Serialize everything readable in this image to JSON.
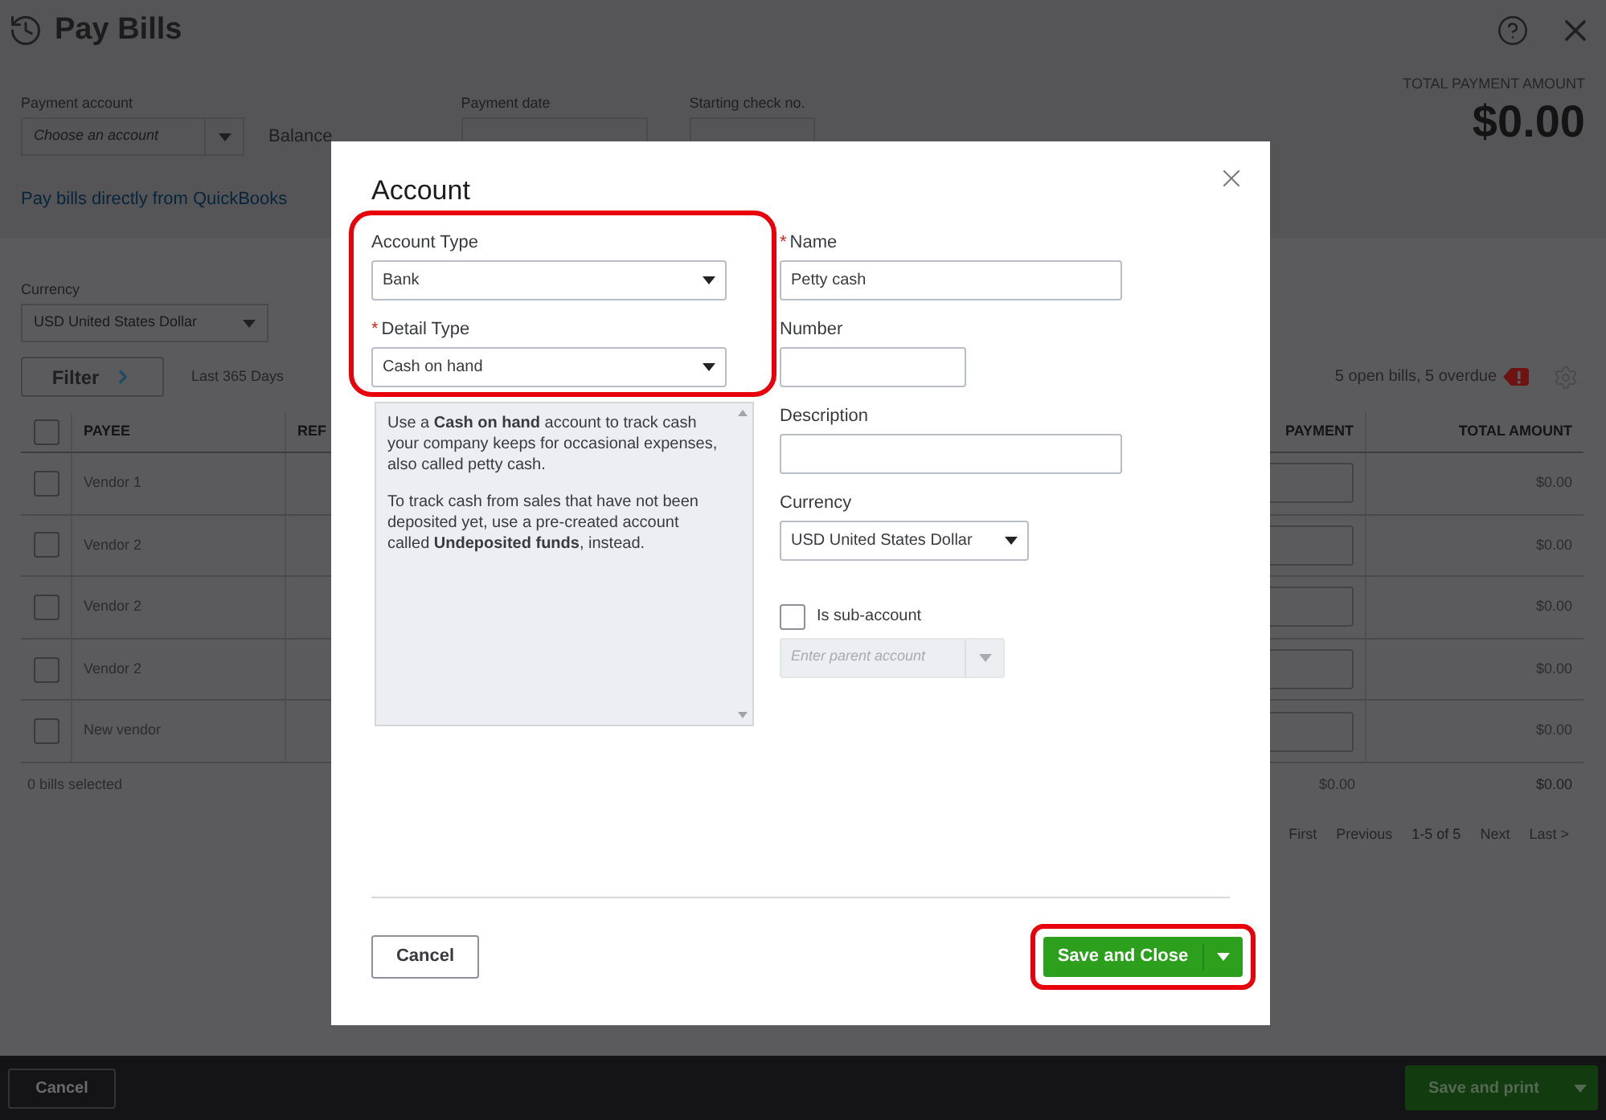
{
  "header": {
    "title": "Pay Bills"
  },
  "payment_account": {
    "label": "Payment account",
    "placeholder": "Choose an account"
  },
  "balance_label": "Balance",
  "payment_date": {
    "label": "Payment date"
  },
  "starting_check": {
    "label": "Starting check no."
  },
  "total": {
    "label": "TOTAL PAYMENT AMOUNT",
    "amount": "$0.00"
  },
  "link": "Pay bills directly from QuickBooks",
  "currency": {
    "label": "Currency",
    "value": "USD United States Dollar"
  },
  "filter": {
    "label": "Filter",
    "range": "Last 365 Days"
  },
  "summary": "5 open bills, 5 overdue",
  "table": {
    "columns": [
      "PAYEE",
      "REF",
      "PAYMENT",
      "TOTAL AMOUNT"
    ],
    "header_checked": false,
    "rows": [
      {
        "payee": "Vendor 1",
        "total": "$0.00",
        "checked": false
      },
      {
        "payee": "Vendor 2",
        "total": "$0.00",
        "checked": false
      },
      {
        "payee": "Vendor 2",
        "total": "$0.00",
        "checked": false
      },
      {
        "payee": "Vendor 2",
        "total": "$0.00",
        "checked": false
      },
      {
        "payee": "New vendor",
        "total": "$0.00",
        "checked": false
      }
    ],
    "footer": {
      "selected": "0 bills selected",
      "payment": "$0.00",
      "total": "$0.00"
    }
  },
  "pagination": [
    {
      "label": "First",
      "kind": "link"
    },
    {
      "label": "Previous",
      "kind": "link"
    },
    {
      "label": "1-5 of 5",
      "kind": "range"
    },
    {
      "label": "Next",
      "kind": "link"
    },
    {
      "label": "Last >",
      "kind": "link"
    }
  ],
  "footer": {
    "cancel": "Cancel",
    "save": "Save and print"
  },
  "dialog": {
    "title": "Account",
    "type_group_highlighted": true,
    "required_mark": "*",
    "account_type": {
      "label": "Account Type",
      "value": "Bank",
      "required": false
    },
    "detail_type": {
      "label": "Detail Type",
      "value": "Cash on hand",
      "required": true
    },
    "help": [
      "Use a **Cash on hand** account to track cash your company keeps for occasional expenses, also called petty cash.",
      "To track cash from sales that have not been deposited yet, use a pre-created account called **Undeposited funds**, instead."
    ],
    "name": {
      "label": "Name",
      "value": "Petty cash",
      "required": true
    },
    "number": {
      "label": "Number"
    },
    "description": {
      "label": "Description"
    },
    "currency": {
      "label": "Currency",
      "value": "USD United States Dollar"
    },
    "sub_account": {
      "label": "Is sub-account",
      "checked": false
    },
    "parent": {
      "placeholder": "Enter parent account",
      "disabled": true
    },
    "cancel": "Cancel",
    "save": {
      "label": "Save and Close",
      "highlighted": true
    }
  }
}
